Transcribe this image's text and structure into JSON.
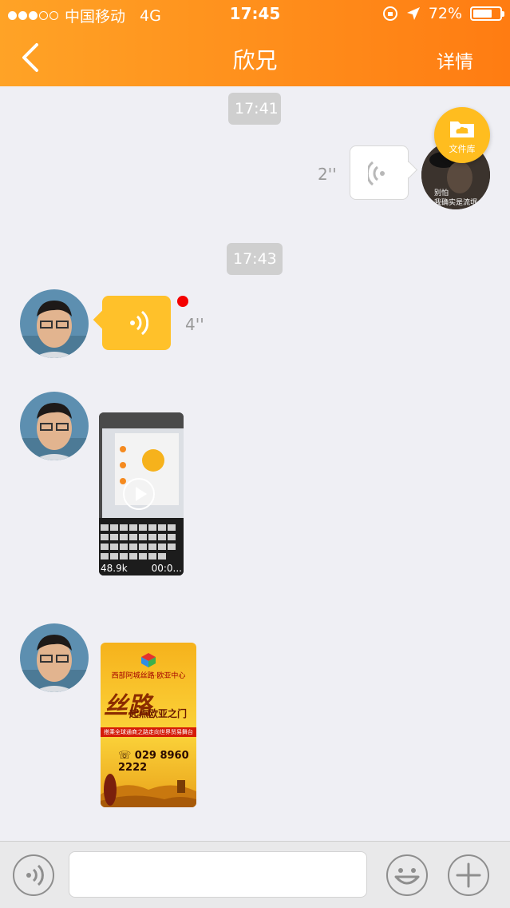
{
  "status_bar": {
    "carrier": "中国移动",
    "network": "4G",
    "time": "17:45",
    "battery": "72%",
    "battery_level": 0.72
  },
  "header": {
    "title": "欣兄",
    "details_label": "详情"
  },
  "messages": [
    {
      "type": "timestamp",
      "text": "17:41"
    },
    {
      "type": "voice",
      "side": "right",
      "duration": "2''"
    },
    {
      "type": "timestamp",
      "text": "17:43"
    },
    {
      "type": "voice",
      "side": "left",
      "duration": "4''",
      "unread": true
    },
    {
      "type": "video",
      "side": "left",
      "size": "48.9k",
      "length": "00:0..."
    },
    {
      "type": "image",
      "side": "left",
      "poster": {
        "brand": "西部阿城丝路·欧亚中心",
        "headline": "丝路",
        "slogan": "起点欧亚之门",
        "strip": "搭乘全球通商之路走向世界贸易舞台",
        "phone": "☏ 029 8960 2222"
      }
    }
  ],
  "file_library": {
    "label": "文件库"
  },
  "self_avatar_caption": {
    "line1": "别怕",
    "line2": "我确实是流氓"
  },
  "colors": {
    "header_start": "#ffa326",
    "header_end": "#ff7c12",
    "voice_bubble_left": "#ffc12a",
    "unread": "#f40000"
  }
}
